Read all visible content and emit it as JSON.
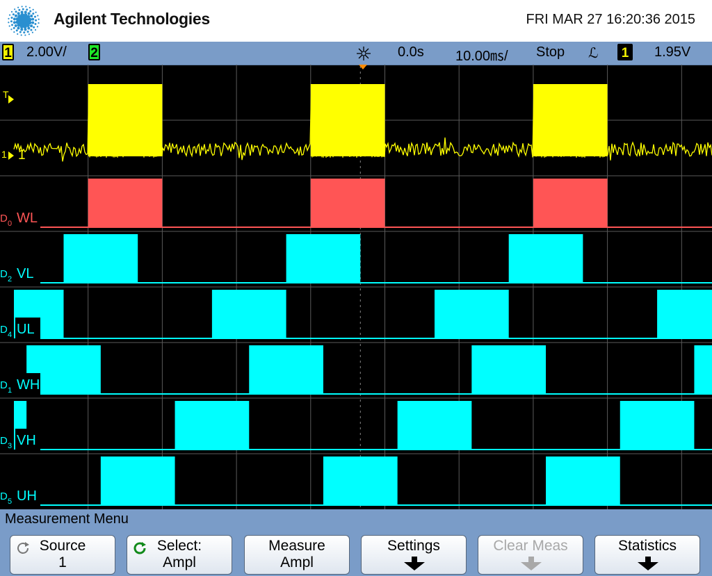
{
  "header": {
    "brand": "Agilent Technologies",
    "datetime": "FRI MAR 27 16:20:36 2015"
  },
  "status_bar": {
    "channel1_badge": "1",
    "channel1_scale": "2.00V/",
    "channel2_badge": "2",
    "delay": "0.0s",
    "timebase": "10.00㎳/",
    "run_state": "Stop",
    "trigger_slope_symbol": "ℒ",
    "trigger_source_badge": "1",
    "trigger_level": "1.95V",
    "channel1_color": "#f2f200",
    "channel2_color": "#1ee628"
  },
  "waveform": {
    "analog_label": "1",
    "trigger_marker": "T",
    "ground_marker": "1",
    "colors": {
      "analog": "#ffff00",
      "d0": "#ff5555",
      "digital": "#00ffff",
      "grid": "#5a5a5a"
    },
    "digital_channels": [
      {
        "id": "D0",
        "num": "0",
        "name": "WL",
        "pulses": [
          [
            1,
            2
          ],
          [
            4,
            5
          ],
          [
            7,
            8
          ]
        ]
      },
      {
        "id": "D2",
        "num": "2",
        "name": "VL",
        "pulses": [
          [
            0.67,
            1.67
          ],
          [
            3.67,
            4.67
          ],
          [
            6.67,
            7.67
          ]
        ]
      },
      {
        "id": "D4",
        "num": "4",
        "name": "UL",
        "pulses": [
          [
            0,
            0.67
          ],
          [
            2.67,
            3.67
          ],
          [
            5.67,
            6.67
          ],
          [
            8.67,
            9.6
          ]
        ]
      },
      {
        "id": "D1",
        "num": "1",
        "name": "WH",
        "pulses": [
          [
            0.17,
            1.17
          ],
          [
            3.17,
            4.17
          ],
          [
            6.17,
            7.17
          ],
          [
            9.17,
            9.6
          ]
        ]
      },
      {
        "id": "D3",
        "num": "3",
        "name": "VH",
        "pulses": [
          [
            0,
            0.17
          ],
          [
            2.17,
            3.17
          ],
          [
            5.17,
            6.17
          ],
          [
            8.17,
            9.17
          ]
        ]
      },
      {
        "id": "D5",
        "num": "5",
        "name": "UH",
        "pulses": [
          [
            1.17,
            2.17
          ],
          [
            4.17,
            5.17
          ],
          [
            7.17,
            8.17
          ]
        ]
      }
    ],
    "analog_pulses": [
      [
        1,
        2
      ],
      [
        4,
        5
      ],
      [
        7,
        8
      ]
    ]
  },
  "menu": {
    "title": "Measurement Menu",
    "softkeys": [
      {
        "line1": "Source",
        "line2": "1",
        "icon": "rotate-knob-icon",
        "enabled": true
      },
      {
        "line1": "Select:",
        "line2": "Ampl",
        "icon": "select-knob-icon",
        "enabled": true
      },
      {
        "line1": "Measure",
        "line2": "Ampl",
        "icon": "",
        "enabled": true
      },
      {
        "line1": "Settings",
        "line2": "",
        "icon": "submenu-arrow-icon",
        "enabled": true
      },
      {
        "line1": "Clear Meas",
        "line2": "",
        "icon": "submenu-arrow-icon",
        "enabled": false
      },
      {
        "line1": "Statistics",
        "line2": "",
        "icon": "submenu-arrow-icon",
        "enabled": true
      }
    ]
  }
}
